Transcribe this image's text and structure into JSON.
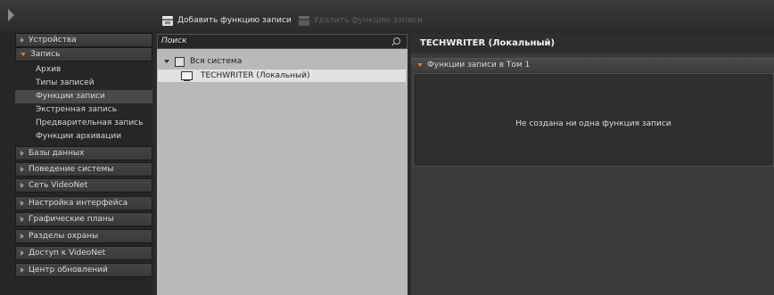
{
  "toolbar": {
    "add_label": "Добавить функцию записи",
    "delete_label": "Удалить функцию записи"
  },
  "nav": {
    "groups": [
      {
        "label": "Устройства"
      },
      {
        "label": "Запись"
      },
      {
        "label": "Базы данных"
      },
      {
        "label": "Поведение системы"
      },
      {
        "label": "Сеть VideoNet"
      },
      {
        "label": "Настройка интерфейса"
      },
      {
        "label": "Графические планы"
      },
      {
        "label": "Разделы охраны"
      },
      {
        "label": "Доступ к VideoNet"
      },
      {
        "label": "Центр обновлений"
      }
    ],
    "recording_items": [
      {
        "label": "Архив"
      },
      {
        "label": "Типы записей"
      },
      {
        "label": "Функции записи",
        "active": true
      },
      {
        "label": "Экстренная запись"
      },
      {
        "label": "Предварительная запись"
      },
      {
        "label": "Функции архивации"
      }
    ]
  },
  "tree": {
    "search_label": "Поиск",
    "root_label": "Вся система",
    "host_label": "TECHWRITER (Локальный)"
  },
  "detail": {
    "title": "TECHWRITER (Локальный)",
    "section_label": "Функции записи в Том 1",
    "empty_message": "Не создана ни одна функция записи"
  },
  "colors": {
    "accent": "#e07a1a",
    "selected_bg": "#4a4a4a"
  }
}
